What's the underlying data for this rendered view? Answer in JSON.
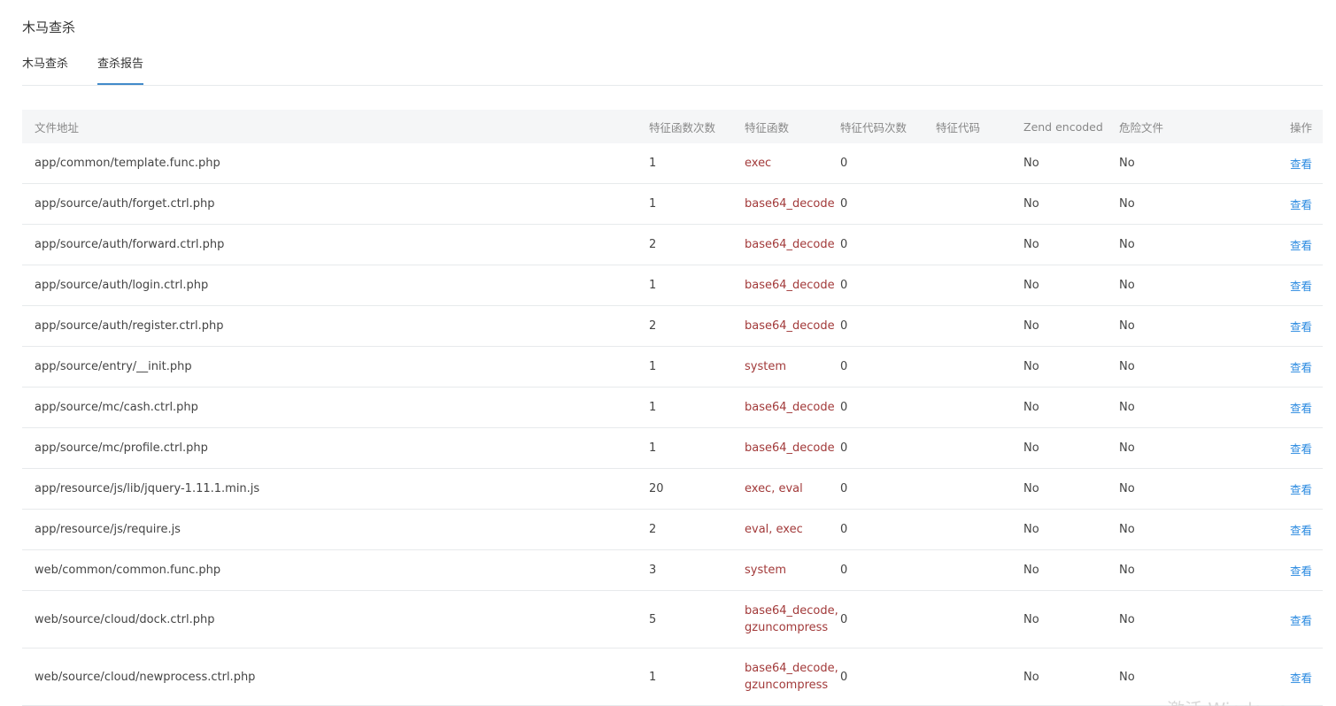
{
  "page": {
    "title": "木马查杀"
  },
  "tabs": [
    {
      "label": "木马查杀",
      "active": false
    },
    {
      "label": "查杀报告",
      "active": true
    }
  ],
  "colors": {
    "accent": "#428bca",
    "function_text": "#a23a3a",
    "link": "#2a8ae0",
    "header_bg": "#f5f6f7"
  },
  "table": {
    "headers": {
      "file": "文件地址",
      "func_count": "特征函数次数",
      "funcs": "特征函数",
      "code_count": "特征代码次数",
      "code": "特征代码",
      "zend": "Zend encoded",
      "danger": "危险文件",
      "op": "操作"
    },
    "rows": [
      {
        "file": "app/common/template.func.php",
        "func_count": "1",
        "funcs": "exec",
        "code_count": "0",
        "code": "",
        "zend": "No",
        "danger": "No",
        "op": "查看"
      },
      {
        "file": "app/source/auth/forget.ctrl.php",
        "func_count": "1",
        "funcs": "base64_decode",
        "code_count": "0",
        "code": "",
        "zend": "No",
        "danger": "No",
        "op": "查看"
      },
      {
        "file": "app/source/auth/forward.ctrl.php",
        "func_count": "2",
        "funcs": "base64_decode",
        "code_count": "0",
        "code": "",
        "zend": "No",
        "danger": "No",
        "op": "查看"
      },
      {
        "file": "app/source/auth/login.ctrl.php",
        "func_count": "1",
        "funcs": "base64_decode",
        "code_count": "0",
        "code": "",
        "zend": "No",
        "danger": "No",
        "op": "查看"
      },
      {
        "file": "app/source/auth/register.ctrl.php",
        "func_count": "2",
        "funcs": "base64_decode",
        "code_count": "0",
        "code": "",
        "zend": "No",
        "danger": "No",
        "op": "查看"
      },
      {
        "file": "app/source/entry/__init.php",
        "func_count": "1",
        "funcs": "system",
        "code_count": "0",
        "code": "",
        "zend": "No",
        "danger": "No",
        "op": "查看"
      },
      {
        "file": "app/source/mc/cash.ctrl.php",
        "func_count": "1",
        "funcs": "base64_decode",
        "code_count": "0",
        "code": "",
        "zend": "No",
        "danger": "No",
        "op": "查看"
      },
      {
        "file": "app/source/mc/profile.ctrl.php",
        "func_count": "1",
        "funcs": "base64_decode",
        "code_count": "0",
        "code": "",
        "zend": "No",
        "danger": "No",
        "op": "查看"
      },
      {
        "file": "app/resource/js/lib/jquery-1.11.1.min.js",
        "func_count": "20",
        "funcs": "exec, eval",
        "code_count": "0",
        "code": "",
        "zend": "No",
        "danger": "No",
        "op": "查看"
      },
      {
        "file": "app/resource/js/require.js",
        "func_count": "2",
        "funcs": "eval, exec",
        "code_count": "0",
        "code": "",
        "zend": "No",
        "danger": "No",
        "op": "查看"
      },
      {
        "file": "web/common/common.func.php",
        "func_count": "3",
        "funcs": "system",
        "code_count": "0",
        "code": "",
        "zend": "No",
        "danger": "No",
        "op": "查看"
      },
      {
        "file": "web/source/cloud/dock.ctrl.php",
        "func_count": "5",
        "funcs": "base64_decode, gzuncompress",
        "code_count": "0",
        "code": "",
        "zend": "No",
        "danger": "No",
        "op": "查看"
      },
      {
        "file": "web/source/cloud/newprocess.ctrl.php",
        "func_count": "1",
        "funcs": "base64_decode, gzuncompress",
        "code_count": "0",
        "code": "",
        "zend": "No",
        "danger": "No",
        "op": "查看"
      }
    ]
  },
  "watermark": {
    "text": "激活 Windows"
  }
}
